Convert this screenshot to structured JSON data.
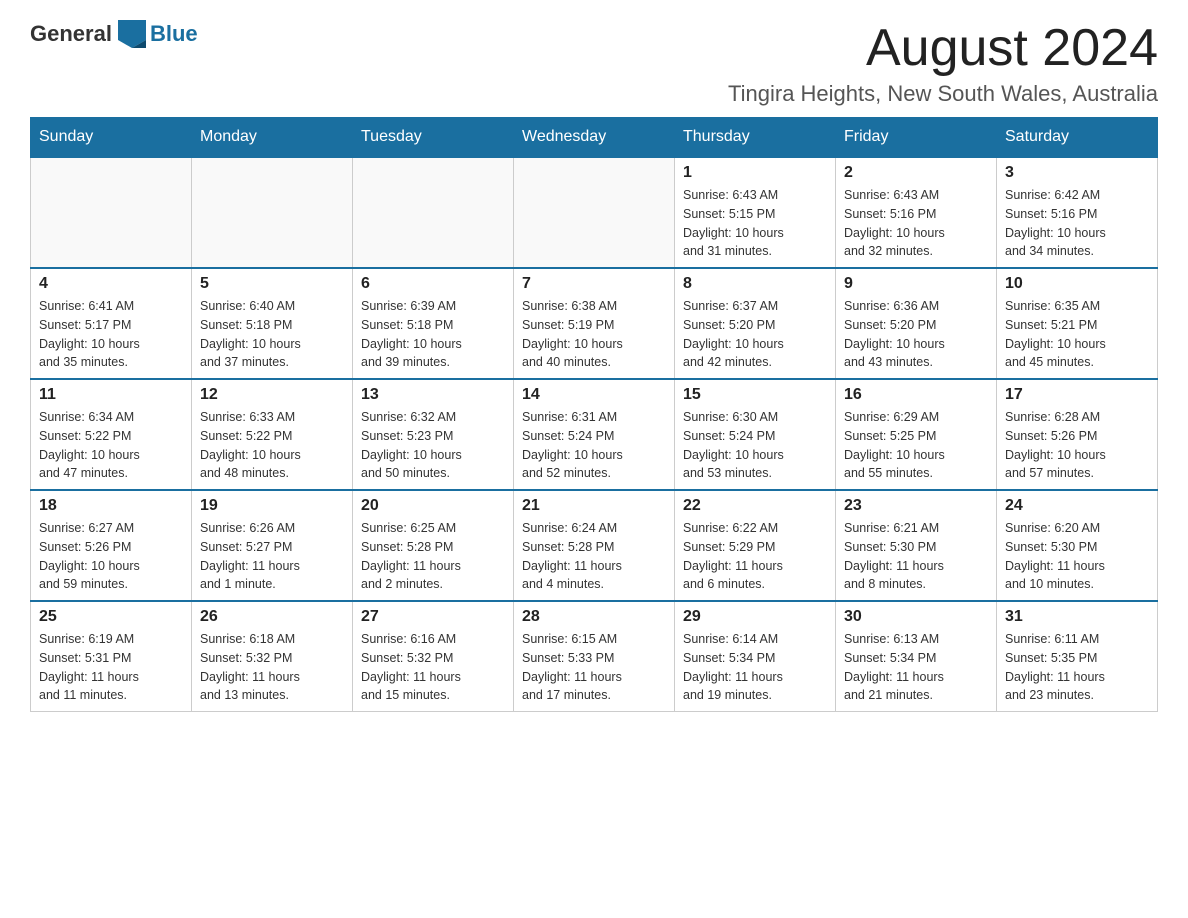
{
  "header": {
    "logo_general": "General",
    "logo_blue": "Blue",
    "month_title": "August 2024",
    "location": "Tingira Heights, New South Wales, Australia"
  },
  "weekdays": [
    "Sunday",
    "Monday",
    "Tuesday",
    "Wednesday",
    "Thursday",
    "Friday",
    "Saturday"
  ],
  "weeks": [
    [
      {
        "day": "",
        "info": ""
      },
      {
        "day": "",
        "info": ""
      },
      {
        "day": "",
        "info": ""
      },
      {
        "day": "",
        "info": ""
      },
      {
        "day": "1",
        "info": "Sunrise: 6:43 AM\nSunset: 5:15 PM\nDaylight: 10 hours\nand 31 minutes."
      },
      {
        "day": "2",
        "info": "Sunrise: 6:43 AM\nSunset: 5:16 PM\nDaylight: 10 hours\nand 32 minutes."
      },
      {
        "day": "3",
        "info": "Sunrise: 6:42 AM\nSunset: 5:16 PM\nDaylight: 10 hours\nand 34 minutes."
      }
    ],
    [
      {
        "day": "4",
        "info": "Sunrise: 6:41 AM\nSunset: 5:17 PM\nDaylight: 10 hours\nand 35 minutes."
      },
      {
        "day": "5",
        "info": "Sunrise: 6:40 AM\nSunset: 5:18 PM\nDaylight: 10 hours\nand 37 minutes."
      },
      {
        "day": "6",
        "info": "Sunrise: 6:39 AM\nSunset: 5:18 PM\nDaylight: 10 hours\nand 39 minutes."
      },
      {
        "day": "7",
        "info": "Sunrise: 6:38 AM\nSunset: 5:19 PM\nDaylight: 10 hours\nand 40 minutes."
      },
      {
        "day": "8",
        "info": "Sunrise: 6:37 AM\nSunset: 5:20 PM\nDaylight: 10 hours\nand 42 minutes."
      },
      {
        "day": "9",
        "info": "Sunrise: 6:36 AM\nSunset: 5:20 PM\nDaylight: 10 hours\nand 43 minutes."
      },
      {
        "day": "10",
        "info": "Sunrise: 6:35 AM\nSunset: 5:21 PM\nDaylight: 10 hours\nand 45 minutes."
      }
    ],
    [
      {
        "day": "11",
        "info": "Sunrise: 6:34 AM\nSunset: 5:22 PM\nDaylight: 10 hours\nand 47 minutes."
      },
      {
        "day": "12",
        "info": "Sunrise: 6:33 AM\nSunset: 5:22 PM\nDaylight: 10 hours\nand 48 minutes."
      },
      {
        "day": "13",
        "info": "Sunrise: 6:32 AM\nSunset: 5:23 PM\nDaylight: 10 hours\nand 50 minutes."
      },
      {
        "day": "14",
        "info": "Sunrise: 6:31 AM\nSunset: 5:24 PM\nDaylight: 10 hours\nand 52 minutes."
      },
      {
        "day": "15",
        "info": "Sunrise: 6:30 AM\nSunset: 5:24 PM\nDaylight: 10 hours\nand 53 minutes."
      },
      {
        "day": "16",
        "info": "Sunrise: 6:29 AM\nSunset: 5:25 PM\nDaylight: 10 hours\nand 55 minutes."
      },
      {
        "day": "17",
        "info": "Sunrise: 6:28 AM\nSunset: 5:26 PM\nDaylight: 10 hours\nand 57 minutes."
      }
    ],
    [
      {
        "day": "18",
        "info": "Sunrise: 6:27 AM\nSunset: 5:26 PM\nDaylight: 10 hours\nand 59 minutes."
      },
      {
        "day": "19",
        "info": "Sunrise: 6:26 AM\nSunset: 5:27 PM\nDaylight: 11 hours\nand 1 minute."
      },
      {
        "day": "20",
        "info": "Sunrise: 6:25 AM\nSunset: 5:28 PM\nDaylight: 11 hours\nand 2 minutes."
      },
      {
        "day": "21",
        "info": "Sunrise: 6:24 AM\nSunset: 5:28 PM\nDaylight: 11 hours\nand 4 minutes."
      },
      {
        "day": "22",
        "info": "Sunrise: 6:22 AM\nSunset: 5:29 PM\nDaylight: 11 hours\nand 6 minutes."
      },
      {
        "day": "23",
        "info": "Sunrise: 6:21 AM\nSunset: 5:30 PM\nDaylight: 11 hours\nand 8 minutes."
      },
      {
        "day": "24",
        "info": "Sunrise: 6:20 AM\nSunset: 5:30 PM\nDaylight: 11 hours\nand 10 minutes."
      }
    ],
    [
      {
        "day": "25",
        "info": "Sunrise: 6:19 AM\nSunset: 5:31 PM\nDaylight: 11 hours\nand 11 minutes."
      },
      {
        "day": "26",
        "info": "Sunrise: 6:18 AM\nSunset: 5:32 PM\nDaylight: 11 hours\nand 13 minutes."
      },
      {
        "day": "27",
        "info": "Sunrise: 6:16 AM\nSunset: 5:32 PM\nDaylight: 11 hours\nand 15 minutes."
      },
      {
        "day": "28",
        "info": "Sunrise: 6:15 AM\nSunset: 5:33 PM\nDaylight: 11 hours\nand 17 minutes."
      },
      {
        "day": "29",
        "info": "Sunrise: 6:14 AM\nSunset: 5:34 PM\nDaylight: 11 hours\nand 19 minutes."
      },
      {
        "day": "30",
        "info": "Sunrise: 6:13 AM\nSunset: 5:34 PM\nDaylight: 11 hours\nand 21 minutes."
      },
      {
        "day": "31",
        "info": "Sunrise: 6:11 AM\nSunset: 5:35 PM\nDaylight: 11 hours\nand 23 minutes."
      }
    ]
  ]
}
